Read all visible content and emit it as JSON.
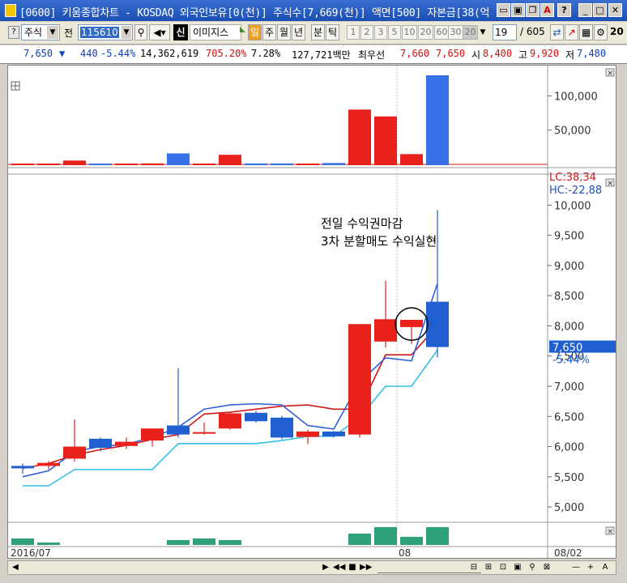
{
  "window": {
    "title": "[0600] 키움종합차트 - KOSDAQ 외국인보유[0(천)] 주식수[7,669(천)] 액면[500] 자본금[38(억"
  },
  "toolbar": {
    "market_select": "주식",
    "code_prefix": "전",
    "stock_code": "115610",
    "stock_name": "이미지스",
    "period_buttons": [
      "일",
      "주",
      "월",
      "년",
      "분",
      "틱"
    ],
    "interval_buttons": [
      "1",
      "2",
      "3",
      "5",
      "10",
      "20",
      "60",
      "30",
      "20"
    ],
    "count_value": "19",
    "count_total": "/ 605",
    "extra_label": "20"
  },
  "info": {
    "price": "7,650",
    "change_arrow": "▼",
    "change": "440",
    "change_rate": "-5.44%",
    "volume": "14,362,619",
    "volume_ratio": "705.20%",
    "turnover": "7.28%",
    "amount": "127,721백만",
    "best_bid_label": "최우선",
    "best_ask": "7,660",
    "best_bid": "7,650",
    "open_label": "시",
    "open": "8,400",
    "high_label": "고",
    "high": "9,920",
    "low_label": "저",
    "low": "7,480"
  },
  "chart_data": {
    "type": "candlestick",
    "title": "",
    "annotation_lines": [
      "전일 수익권마감",
      "3차 분할매도 수익실현"
    ],
    "upper_band_label": "LC:38,34",
    "lower_band_label": "HC:-22,88",
    "current_price_label": "7,650",
    "current_change_label": "-5.44%",
    "ylim": [
      4800,
      10300
    ],
    "price_ticks": [
      "10,000",
      "9,500",
      "9,000",
      "8,500",
      "8,000",
      "7,500",
      "7,000",
      "6,500",
      "6,000",
      "5,500",
      "5,000"
    ],
    "price_tick_values": [
      10000,
      9500,
      9000,
      8500,
      8000,
      7500,
      7000,
      6500,
      6000,
      5500,
      5000
    ],
    "volume_ticks": [
      "100,000",
      "50,000"
    ],
    "volume_tick_values": [
      100000,
      50000
    ],
    "volume_ylim": [
      0,
      130000
    ],
    "x_labels": [
      "2016/07",
      "08",
      "08/02"
    ],
    "colors": {
      "up": "#e8221a",
      "down": "#1f5fd0",
      "ma_red": "#d01818",
      "ma_blue": "#3060d8",
      "ma_cyan": "#30c0e8",
      "lower_vol": "#2ea07a"
    },
    "candles": [
      {
        "o": 5680,
        "h": 5720,
        "l": 5550,
        "c": 5640
      },
      {
        "o": 5680,
        "h": 5760,
        "l": 5620,
        "c": 5730
      },
      {
        "o": 5800,
        "h": 6450,
        "l": 5750,
        "c": 6000
      },
      {
        "o": 6130,
        "h": 6150,
        "l": 5920,
        "c": 5980
      },
      {
        "o": 6010,
        "h": 6150,
        "l": 5960,
        "c": 6080
      },
      {
        "o": 6100,
        "h": 6300,
        "l": 6000,
        "c": 6300
      },
      {
        "o": 6350,
        "h": 7300,
        "l": 6150,
        "c": 6200
      },
      {
        "o": 6220,
        "h": 6400,
        "l": 6200,
        "c": 6240
      },
      {
        "o": 6300,
        "h": 6560,
        "l": 6280,
        "c": 6550
      },
      {
        "o": 6560,
        "h": 6590,
        "l": 6400,
        "c": 6420
      },
      {
        "o": 6480,
        "h": 6510,
        "l": 6120,
        "c": 6150
      },
      {
        "o": 6160,
        "h": 6280,
        "l": 6040,
        "c": 6250
      },
      {
        "o": 6250,
        "h": 6260,
        "l": 6150,
        "c": 6170
      },
      {
        "o": 6200,
        "h": 8030,
        "l": 6150,
        "c": 8030
      },
      {
        "o": 7740,
        "h": 8750,
        "l": 7640,
        "c": 8110
      },
      {
        "o": 7980,
        "h": 8100,
        "l": 7700,
        "c": 8100
      },
      {
        "o": 8400,
        "h": 9920,
        "l": 7480,
        "c": 7650
      }
    ],
    "ma_red": [
      5640,
      5720,
      5860,
      5950,
      6020,
      6120,
      6200,
      6540,
      6570,
      6620,
      6670,
      6690,
      6620,
      6620,
      7520,
      7520,
      8000
    ],
    "ma_blue": [
      5500,
      5600,
      5920,
      6000,
      6040,
      6150,
      6320,
      6620,
      6690,
      6710,
      6690,
      6350,
      6290,
      7070,
      7470,
      7420,
      8700
    ],
    "ma_cyan": [
      5350,
      5350,
      5620,
      5620,
      5620,
      5620,
      6050,
      6050,
      6050,
      6050,
      6100,
      6170,
      6170,
      6480,
      7000,
      7000,
      7600
    ],
    "volumes": [
      800,
      1200,
      5600,
      900,
      900,
      1400,
      16000,
      1200,
      14000,
      1400,
      1400,
      1100,
      2000,
      80000,
      70000,
      15000,
      130000
    ],
    "volume_up": [
      true,
      true,
      true,
      false,
      true,
      true,
      false,
      true,
      true,
      false,
      false,
      true,
      false,
      true,
      true,
      true,
      false
    ],
    "lower_volume": [
      8,
      3,
      0,
      0,
      0,
      0,
      6,
      8,
      6,
      0,
      0,
      0,
      0,
      14,
      22,
      10,
      22
    ]
  }
}
